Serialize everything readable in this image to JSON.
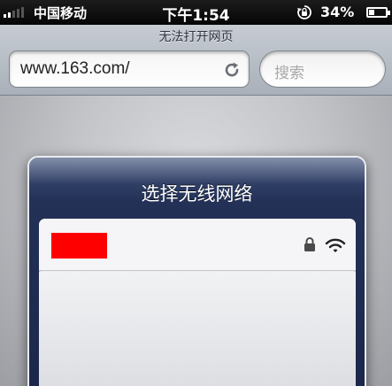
{
  "status_bar": {
    "carrier": "中国移动",
    "time": "下午1:54",
    "battery_percent": "34%",
    "battery_level": 0.34,
    "signal_bars_filled": 2,
    "signal_bars_total": 5,
    "icons": [
      "signal-icon",
      "rotation-lock-icon",
      "battery-icon"
    ]
  },
  "browser": {
    "page_title": "无法打开网页",
    "url": "www.163.com/",
    "search_placeholder": "搜索",
    "icons": [
      "reload-icon"
    ]
  },
  "wifi_picker": {
    "title": "选择无线网络",
    "networks": [
      {
        "name_redacted": true,
        "secured": true,
        "icons": [
          "padlock-icon",
          "wifi-icon"
        ]
      }
    ],
    "redaction_color": "#ff0000"
  },
  "colors": {
    "popup_navy": "#233157",
    "list_background": "#ecedf0"
  }
}
